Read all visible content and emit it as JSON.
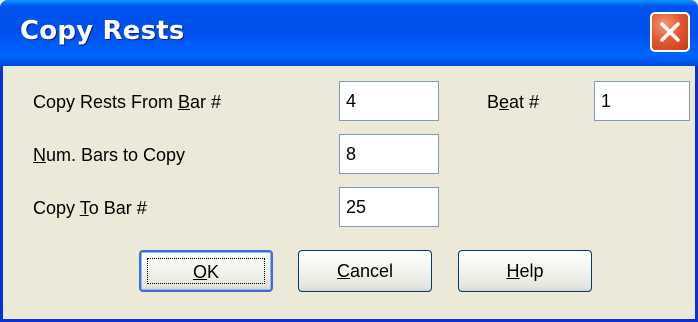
{
  "dialog": {
    "title": "Copy Rests"
  },
  "fields": {
    "from_bar": {
      "label_pre": "Copy Rests From ",
      "label_u": "B",
      "label_post": "ar #",
      "value": "4"
    },
    "beat": {
      "label_pre": "B",
      "label_u": "e",
      "label_post": "at #",
      "value": "1"
    },
    "num_bars": {
      "label_pre": "",
      "label_u": "N",
      "label_post": "um. Bars to Copy",
      "value": "8"
    },
    "to_bar": {
      "label_pre": "Copy ",
      "label_u": "T",
      "label_post": "o Bar #",
      "value": "25"
    }
  },
  "buttons": {
    "ok": {
      "label_u": "O",
      "label_post": "K"
    },
    "cancel": {
      "label_u": "C",
      "label_post": "ancel"
    },
    "help": {
      "label_u": "H",
      "label_post": "elp"
    }
  },
  "colors": {
    "titlebar": "#0053ee",
    "close_button": "#e25a33",
    "dialog_bg": "#ece9d8"
  },
  "icons": {
    "close": "close-icon"
  }
}
